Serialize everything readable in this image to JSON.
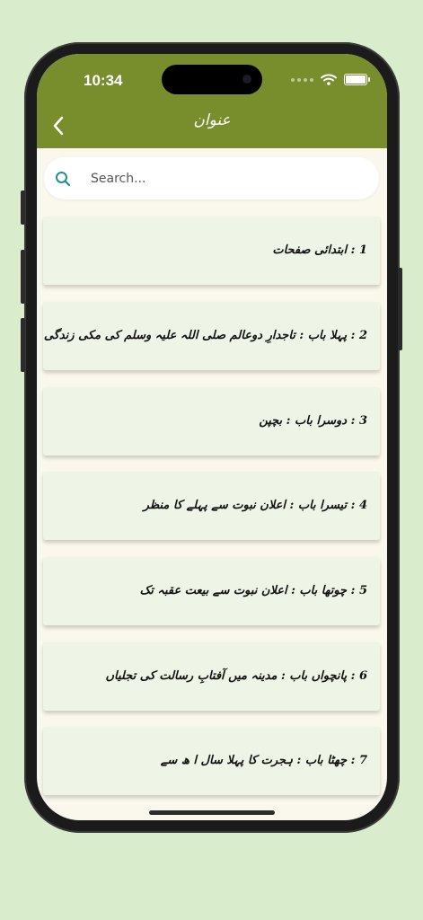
{
  "status_bar": {
    "time": "10:34"
  },
  "header": {
    "title": "عنوان"
  },
  "search": {
    "placeholder": "Search..."
  },
  "chapters": [
    {
      "label": "1 : ابتدائی صفحات"
    },
    {
      "label": "2 : پہلا باب : تاجدارِ دوعالم صلی اللہ علیہ وسلم کی مکی زندگی"
    },
    {
      "label": "3 : دوسرا باب : بچپن"
    },
    {
      "label": "4 : تیسرا باب : اعلان نبوت سے پہلے کا منظر"
    },
    {
      "label": "5 : چوتھا باب : اعلان نبوت سے بیعت عقبہ تک"
    },
    {
      "label": "6 : پانچواں باب : مدینہ میں آفتابِ رسالت کی تجلیاں"
    },
    {
      "label": "7 : چھٹا باب : ہجرت کا پہلا سال ا ھ سے"
    }
  ],
  "colors": {
    "header_bg": "#788e2c",
    "page_bg": "#d9eccb",
    "search_icon": "#1f8f8f"
  }
}
